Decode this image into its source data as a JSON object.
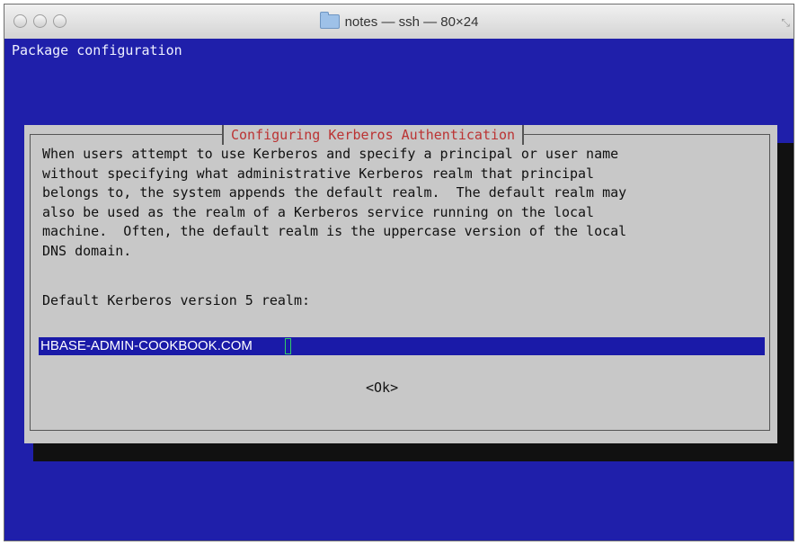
{
  "window": {
    "title": "notes — ssh — 80×24",
    "colors": {
      "terminal_bg": "#1f1faa",
      "dialog_bg": "#c8c8c8",
      "dialog_title": "#bb3333",
      "field_bg": "#1a1aa8"
    }
  },
  "terminal": {
    "header": "Package configuration"
  },
  "dialog": {
    "title": "Configuring Kerberos Authentication",
    "description": "When users attempt to use Kerberos and specify a principal or user name\nwithout specifying what administrative Kerberos realm that principal\nbelongs to, the system appends the default realm.  The default realm may\nalso be used as the realm of a Kerberos service running on the local\nmachine.  Often, the default realm is the uppercase version of the local\nDNS domain.",
    "prompt": "Default Kerberos version 5 realm:",
    "realm_value": "HBASE-ADMIN-COOKBOOK.COM",
    "ok_label": "<Ok>"
  }
}
